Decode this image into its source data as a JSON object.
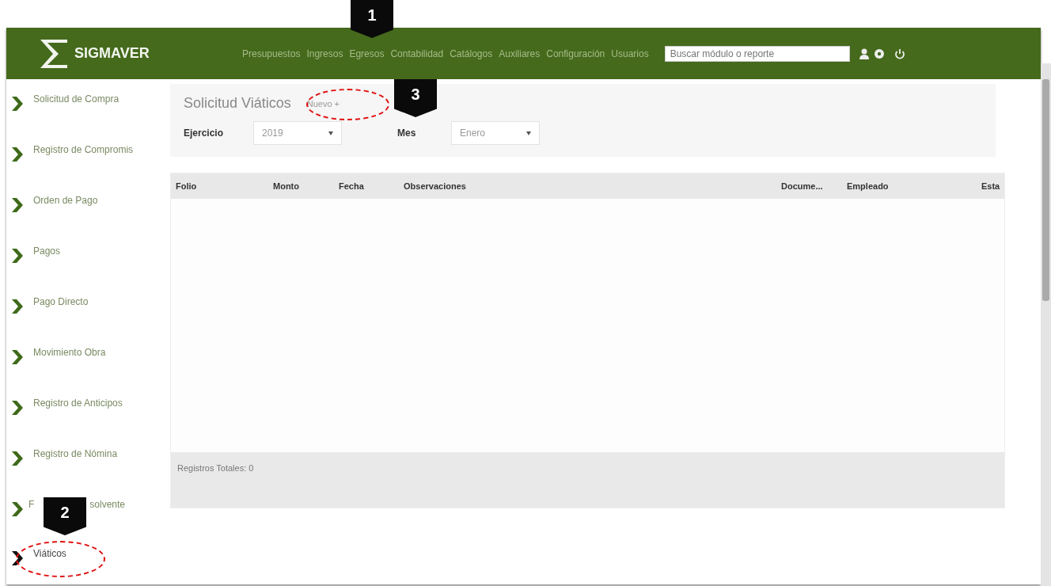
{
  "header": {
    "brand": "SIGMAVER",
    "nav": [
      "Presupuestos",
      "Ingresos",
      "Egresos",
      "Contabilidad",
      "Catálogos",
      "Auxiliares",
      "Configuración",
      "Usuarios"
    ],
    "search": {
      "placeholder": "Buscar módulo o reporte"
    }
  },
  "sidebar": {
    "items": [
      {
        "kind": "text",
        "label": "Solicitud de Compra",
        "selected": false
      },
      {
        "kind": "text",
        "label": "Registro de Compromis",
        "selected": false
      },
      {
        "kind": "text",
        "label": "Orden de Pago",
        "selected": false
      },
      {
        "kind": "text",
        "label": "Pagos",
        "selected": false
      },
      {
        "kind": "text",
        "label": "Pago Directo",
        "selected": false
      },
      {
        "kind": "text",
        "label": "Movimiento Obra",
        "selected": false
      },
      {
        "kind": "text",
        "label": "Registro de Anticipos",
        "selected": false
      },
      {
        "kind": "text",
        "label": "Registro de Nómina",
        "selected": false
      },
      {
        "kind": "covered",
        "label_start": "F",
        "label_end": "solvente",
        "selected": false
      },
      {
        "kind": "text",
        "label": "Viáticos",
        "selected": true
      }
    ]
  },
  "panel": {
    "title": "Solicitud Viáticos",
    "new_button": "Nuevo +",
    "filters": [
      {
        "label": "Ejercicio",
        "value": "2019"
      },
      {
        "label": "Mes",
        "value": "Enero"
      }
    ]
  },
  "table": {
    "columns": [
      "Folio",
      "Monto",
      "Fecha",
      "Observaciones",
      "Docume...",
      "Empleado",
      "Esta"
    ],
    "footer": "Registros Totales: 0"
  },
  "callouts": [
    {
      "number": "1",
      "kind": "plain"
    },
    {
      "number": "3",
      "kind": "ringed"
    },
    {
      "number": "2",
      "kind": "ringed"
    }
  ]
}
